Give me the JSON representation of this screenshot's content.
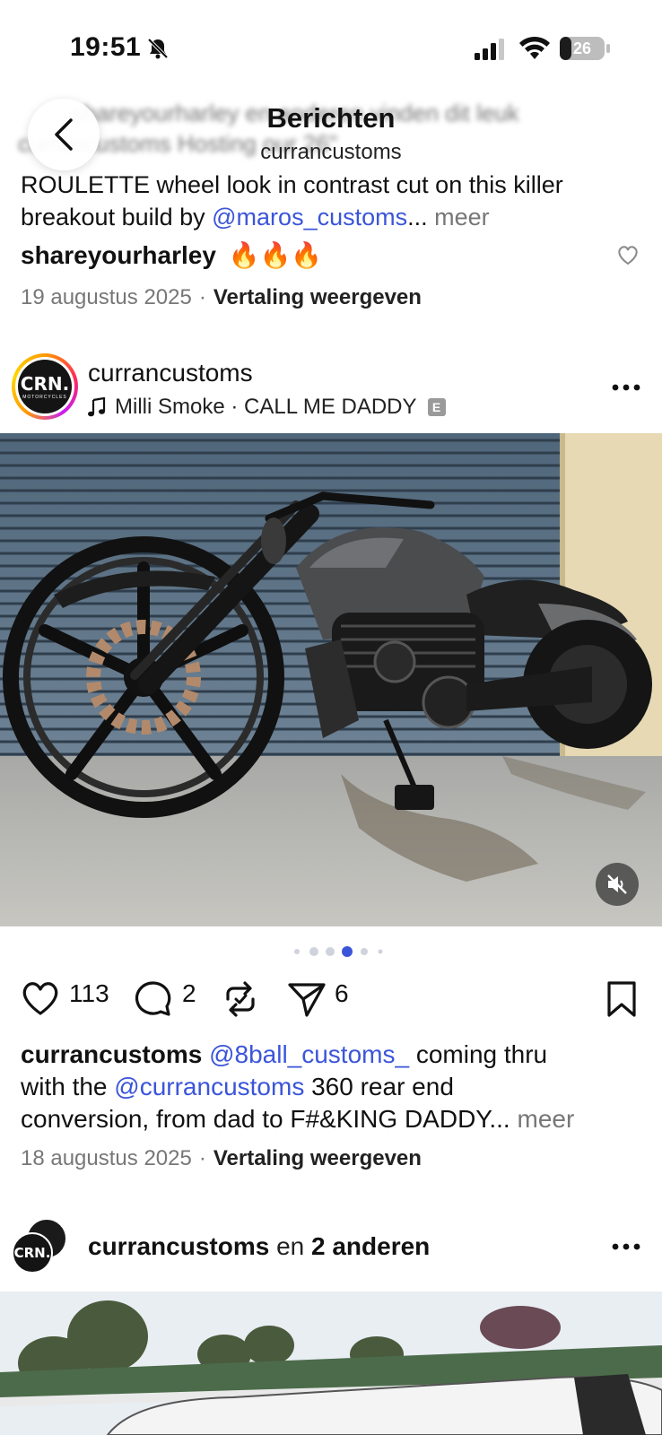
{
  "status_bar": {
    "time": "19:51",
    "battery": "26",
    "battery_level": 0.26
  },
  "ghost_text": {
    "line1": "shareyourharley en anderen vinden dit leuk",
    "line2": "currancustoms Hosting our 26\""
  },
  "header": {
    "title": "Berichten",
    "subtitle": "currancustoms"
  },
  "prev_post": {
    "caption_line1": "ROULETTE wheel look in contrast cut on this killer",
    "caption_line2_prefix": "breakout build by ",
    "caption_mention": "@maros_customs",
    "caption_ellipsis": "...",
    "more": " meer",
    "comment_user": "shareyourharley",
    "comment_text": "🔥🔥🔥",
    "date": "19 augustus 2025",
    "separator": "·",
    "translate": "Vertaling weergeven"
  },
  "post": {
    "username": "currancustoms",
    "avatar_text": "CRN.",
    "avatar_subtext": "MOTORCYCLES",
    "music": "Milli Smoke · CALL ME DADDY",
    "explicit": "E",
    "carousel": {
      "count": 6,
      "active": 4
    },
    "likes": "113",
    "comments": "2",
    "shares": "6",
    "caption_user": "currancustoms",
    "caption_mention1": "@8ball_customs_",
    "caption_text1": " coming thru",
    "caption_line2_prefix": "with the ",
    "caption_mention2": "@currancustoms",
    "caption_text2": " 360 rear end",
    "caption_line3": "conversion, from dad to F#&KING DADDY",
    "caption_ellipsis": "...",
    "more": " meer",
    "date": "18 augustus 2025",
    "separator": "·",
    "translate": "Vertaling weergeven"
  },
  "next_post": {
    "username": "currancustoms",
    "collab_text": " en ",
    "collab_others": "2 anderen",
    "avatar_text": "CRN."
  },
  "colors": {
    "mention": "#3b55d9",
    "pager_active": "#3b55d9"
  }
}
